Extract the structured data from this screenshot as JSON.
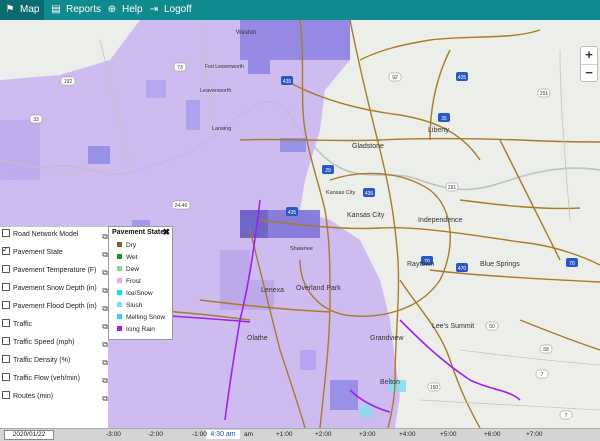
{
  "nav": {
    "tabs": [
      {
        "label": "Map",
        "icon": "map-icon",
        "glyph": "⚑"
      },
      {
        "label": "Reports",
        "icon": "reports-icon",
        "glyph": "▤"
      },
      {
        "label": "Help",
        "icon": "help-icon",
        "glyph": "⊕"
      },
      {
        "label": "Logoff",
        "icon": "logoff-icon",
        "glyph": "⇥"
      }
    ],
    "active": "Map"
  },
  "zoom": {
    "in_label": "+",
    "out_label": "−"
  },
  "map": {
    "places": {
      "weston": "Weston",
      "fort_leavenworth": "Fort Leavenworth",
      "leavenworth": "Leavenworth",
      "lansing": "Lansing",
      "gladstone": "Gladstone",
      "liberty": "Liberty",
      "kansas_city_kansas": "Kansas City",
      "kansas_city": "Kansas City",
      "independence": "Independence",
      "raytown": "Raytown",
      "blue_springs": "Blue Springs",
      "shawnee": "Shawnee",
      "lenexa": "Lenexa",
      "overland_park": "Overland Park",
      "lees_summit": "Lee's Summit",
      "olathe": "Olathe",
      "grandview": "Grandview",
      "belton": "Belton"
    },
    "highway_labels": [
      "192",
      "73",
      "92",
      "435",
      "435",
      "291",
      "35",
      "435",
      "29",
      "24-40",
      "435",
      "70",
      "70",
      "470",
      "50",
      "150",
      "291",
      "58",
      "7",
      "7",
      "33"
    ]
  },
  "layers": {
    "items": [
      {
        "label": "Road Network Model",
        "checked": false
      },
      {
        "label": "Pavement State",
        "checked": true
      },
      {
        "label": "Pavement Temperature (F)",
        "checked": false
      },
      {
        "label": "Pavement Snow Depth (in)",
        "checked": false
      },
      {
        "label": "Pavement Flood Depth (in)",
        "checked": false
      },
      {
        "label": "Traffic",
        "checked": false
      },
      {
        "label": "Traffic Speed (mph)",
        "checked": false
      },
      {
        "label": "Traffic Density (%)",
        "checked": false
      },
      {
        "label": "Traffic Flow (veh/min)",
        "checked": false
      },
      {
        "label": "Routes (min)",
        "checked": false
      }
    ]
  },
  "legend": {
    "title": "Pavement State",
    "close_label": "✖",
    "items": [
      {
        "label": "Dry",
        "color": "#8b5a2b"
      },
      {
        "label": "Wet",
        "color": "#1f8f1f"
      },
      {
        "label": "Dew",
        "color": "#7fe07f"
      },
      {
        "label": "Frost",
        "color": "#f2a6e6"
      },
      {
        "label": "Ice/Snow",
        "color": "#00e5ee"
      },
      {
        "label": "Slush",
        "color": "#7fd6ff"
      },
      {
        "label": "Melting Snow",
        "color": "#40c9ff"
      },
      {
        "label": "Icing Rain",
        "color": "#a020f0"
      }
    ]
  },
  "timebar": {
    "date": "2020/01/22",
    "now": "4:30 am",
    "ticks": [
      "-3:00",
      "-2:00",
      "-1:00",
      "am",
      "+1:00",
      "+2:00",
      "+3:00",
      "+4:00",
      "+5:00",
      "+6:00",
      "+7:00"
    ]
  },
  "colors": {
    "nav_bg": "#0f8a8f",
    "frost_overlay": "#c9b3f2",
    "ice_overlay": "#8080e8",
    "road": "#a87b2a",
    "icing_route": "#a020f0"
  }
}
